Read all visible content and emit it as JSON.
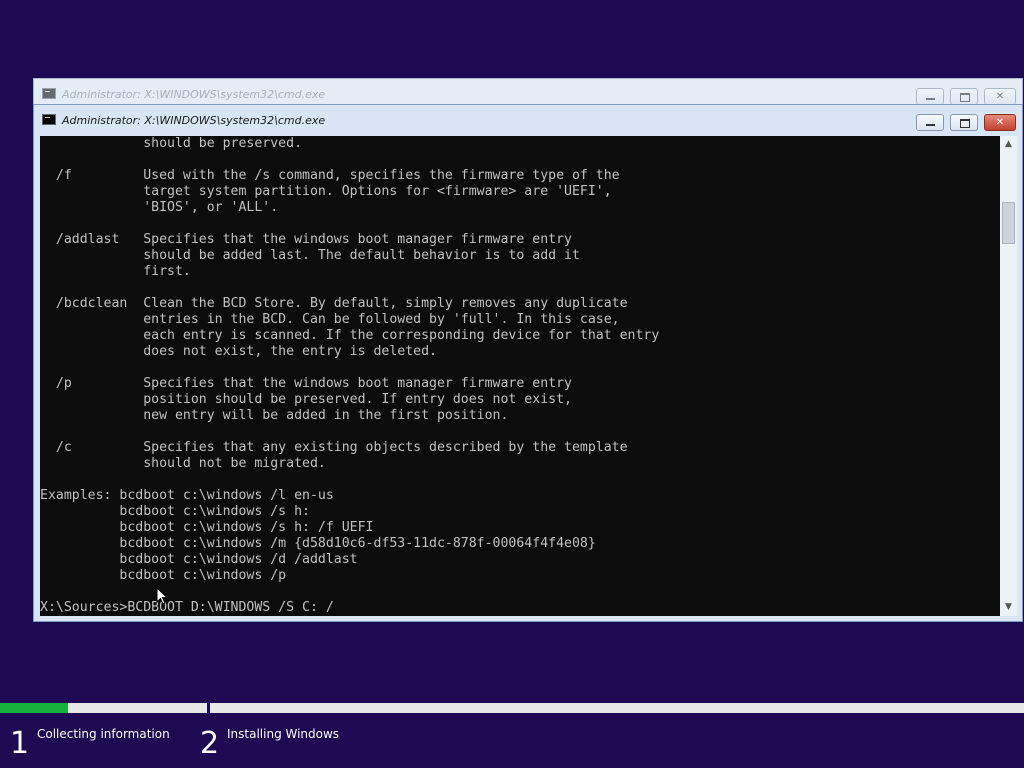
{
  "background_window": {
    "title": "Administrator: X:\\WINDOWS\\system32\\cmd.exe"
  },
  "front_window": {
    "title": "Administrator: X:\\WINDOWS\\system32\\cmd.exe",
    "console_lines": [
      "             should be preserved.",
      "",
      "  /f         Used with the /s command, specifies the firmware type of the",
      "             target system partition. Options for <firmware> are 'UEFI',",
      "             'BIOS', or 'ALL'.",
      "",
      "  /addlast   Specifies that the windows boot manager firmware entry",
      "             should be added last. The default behavior is to add it",
      "             first.",
      "",
      "  /bcdclean  Clean the BCD Store. By default, simply removes any duplicate",
      "             entries in the BCD. Can be followed by 'full'. In this case,",
      "             each entry is scanned. If the corresponding device for that entry",
      "             does not exist, the entry is deleted.",
      "",
      "  /p         Specifies that the windows boot manager firmware entry",
      "             position should be preserved. If entry does not exist,",
      "             new entry will be added in the first position.",
      "",
      "  /c         Specifies that any existing objects described by the template",
      "             should not be migrated.",
      "",
      "Examples: bcdboot c:\\windows /l en-us",
      "          bcdboot c:\\windows /s h:",
      "          bcdboot c:\\windows /s h: /f UEFI",
      "          bcdboot c:\\windows /m {d58d10c6-df53-11dc-878f-00064f4f4e08}",
      "          bcdboot c:\\windows /d /addlast",
      "          bcdboot c:\\windows /p",
      "",
      "X:\\Sources>BCDBOOT D:\\WINDOWS /S C: /"
    ]
  },
  "setup": {
    "progress_fraction": 0.33,
    "progress_color": "#16b13a",
    "steps": [
      {
        "number": "1",
        "label": "Collecting information"
      },
      {
        "number": "2",
        "label": "Installing Windows"
      }
    ]
  },
  "colors": {
    "desktop_bg": "#1d0a52",
    "console_bg": "#0c0c0c",
    "console_text": "#c0c0c0"
  }
}
